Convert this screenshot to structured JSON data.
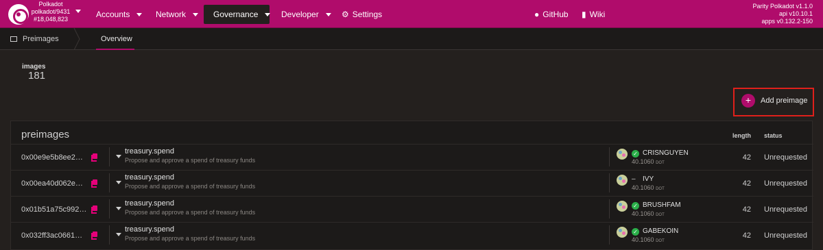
{
  "chain": {
    "name": "Polkadot",
    "runtime": "polkadot/9431",
    "block": "#18,048,823"
  },
  "nav": {
    "accounts": "Accounts",
    "network": "Network",
    "governance": "Governance",
    "developer": "Developer",
    "settings": "Settings",
    "github": "GitHub",
    "wiki": "Wiki"
  },
  "version": {
    "node": "Parity Polkadot v1.1.0",
    "api": "api v10.10.1",
    "apps": "apps v0.132.2-150"
  },
  "subnav": {
    "title": "Preimages",
    "tab": "Overview"
  },
  "summary": {
    "label": "images",
    "value": "181"
  },
  "actions": {
    "add_label": "Add preimage",
    "add_symbol": "+"
  },
  "table": {
    "title": "preimages",
    "col_length": "length",
    "col_status": "status",
    "rows": [
      {
        "hash": "0x00e9e5b8ee2…",
        "call": "treasury.spend",
        "desc": "Propose and approve a spend of treasury funds",
        "proposer": "CRISNGUYEN",
        "verified": true,
        "bond": "40.1060",
        "unit": "DOT",
        "length": "42",
        "status": "Unrequested"
      },
      {
        "hash": "0x00ea40d062e…",
        "call": "treasury.spend",
        "desc": "Propose and approve a spend of treasury funds",
        "proposer": "IVY",
        "verified": false,
        "bond": "40.1060",
        "unit": "DOT",
        "length": "42",
        "status": "Unrequested"
      },
      {
        "hash": "0x01b51a75c992…",
        "call": "treasury.spend",
        "desc": "Propose and approve a spend of treasury funds",
        "proposer": "BRUSHFAM",
        "verified": true,
        "bond": "40.1060",
        "unit": "DOT",
        "length": "42",
        "status": "Unrequested"
      },
      {
        "hash": "0x032ff3ac0661…",
        "call": "treasury.spend",
        "desc": "Propose and approve a spend of treasury funds",
        "proposer": "GABEKOIN",
        "verified": true,
        "bond": "40.1060",
        "unit": "DOT",
        "length": "42",
        "status": "Unrequested"
      }
    ]
  },
  "colors": {
    "brand": "#b00c6b",
    "accent": "#e6007a",
    "background": "#24201e",
    "verified": "#2bb04a",
    "highlight_box": "#e0201b"
  },
  "icons": {
    "chain_logo": "polkadot-logo-icon",
    "settings": "gear-icon",
    "github": "github-icon",
    "wiki": "book-icon",
    "copy": "copy-icon",
    "add": "plus-icon"
  }
}
